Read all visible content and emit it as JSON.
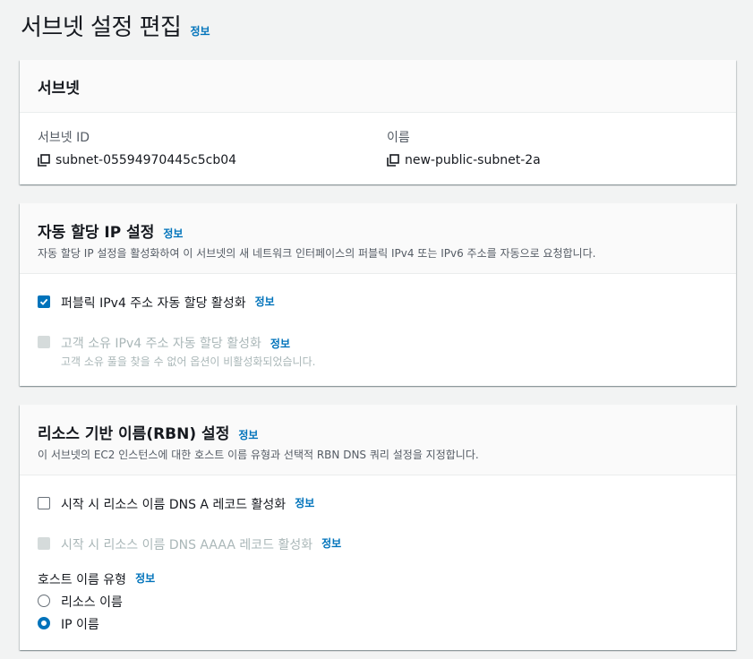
{
  "page": {
    "title": "서브넷 설정 편집",
    "info": "정보"
  },
  "subnet_panel": {
    "title": "서브넷",
    "subnet_id_label": "서브넷 ID",
    "subnet_id_value": "subnet-05594970445c5cb04",
    "name_label": "이름",
    "name_value": "new-public-subnet-2a"
  },
  "auto_ip_panel": {
    "title": "자동 할당 IP 설정",
    "info": "정보",
    "description": "자동 할당 IP 설정을 활성화하여 이 서브넷의 새 네트워크 인터페이스의 퍼블릭 IPv4 또는 IPv6 주소를 자동으로 요청합니다.",
    "opt_public_ipv4": {
      "label": "퍼블릭 IPv4 주소 자동 할당 활성화",
      "info": "정보",
      "checked": true
    },
    "opt_customer_ipv4": {
      "label": "고객 소유 IPv4 주소 자동 할당 활성화",
      "info": "정보",
      "sub": "고객 소유 풀을 찾을 수 없어 옵션이 비활성화되었습니다.",
      "disabled": true
    }
  },
  "rbn_panel": {
    "title": "리소스 기반 이름(RBN) 설정",
    "info": "정보",
    "description": "이 서브넷의 EC2 인스턴스에 대한 호스트 이름 유형과 선택적 RBN DNS 쿼리 설정을 지정합니다.",
    "opt_dns_a": {
      "label": "시작 시 리소스 이름 DNS A 레코드 활성화",
      "info": "정보",
      "checked": false
    },
    "opt_dns_aaaa": {
      "label": "시작 시 리소스 이름 DNS AAAA 레코드 활성화",
      "info": "정보",
      "disabled": true
    },
    "hostname_type_label": "호스트 이름 유형",
    "hostname_type_info": "정보",
    "radio_resource_name": {
      "label": "리소스 이름",
      "selected": false
    },
    "radio_ip_name": {
      "label": "IP 이름",
      "selected": true
    }
  },
  "colors": {
    "accent": "#0073bb",
    "disabled": "#aab7b8",
    "background": "#f2f3f3"
  }
}
